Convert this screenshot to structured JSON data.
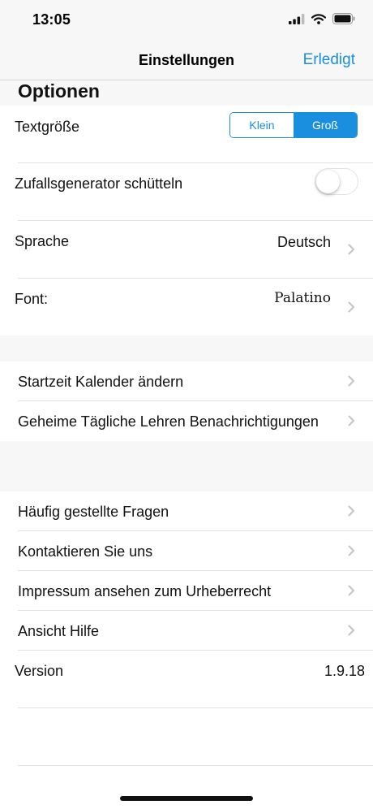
{
  "status": {
    "time": "13:05"
  },
  "nav": {
    "title": "Einstellungen",
    "done_label": "Erledigt"
  },
  "options": {
    "header": "Optionen",
    "text_size": {
      "label": "Textgröße",
      "segments": [
        "Klein",
        "Groß"
      ],
      "selected": "Groß"
    },
    "shake": {
      "label": "Zufallsgenerator schütteln",
      "enabled": false
    },
    "language": {
      "label": "Sprache",
      "value": "Deutsch"
    },
    "font": {
      "label": "Font:",
      "value": "Palatino"
    }
  },
  "section2": {
    "items": [
      {
        "label": "Startzeit Kalender ändern"
      },
      {
        "label": "Geheime Tägliche Lehren Benachrichtigungen"
      }
    ]
  },
  "section3": {
    "items": [
      {
        "label": "Häufig gestellte Fragen"
      },
      {
        "label": "Kontaktieren Sie uns"
      },
      {
        "label": "Impressum ansehen zum Urheberrecht"
      },
      {
        "label": "Ansicht Hilfe"
      }
    ]
  },
  "version": {
    "label": "Version",
    "value": "1.9.18"
  },
  "colors": {
    "accent": "#1a8fe0",
    "grouped_background": "#f7f7f7",
    "separator": "#e1e1e4"
  }
}
